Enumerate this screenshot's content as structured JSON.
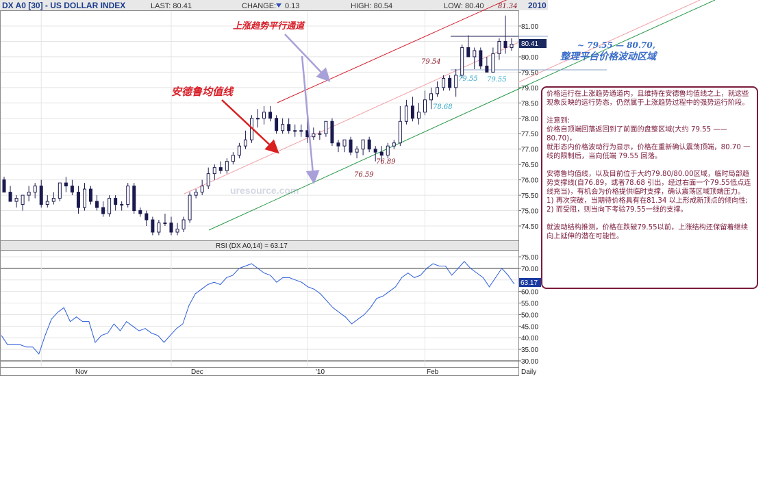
{
  "header": {
    "title": "DX A0 [30] - US DOLLAR INDEX",
    "last": "LAST: 80.41",
    "change_label": "CHANGE:",
    "change_value": "0.13",
    "high": "HIGH: 80.54",
    "low": "LOW: 80.40",
    "year": "2010"
  },
  "colors": {
    "candle_up": "#ffffff",
    "candle_down": "#1a1a50",
    "channel_upper": "#d42030",
    "channel_mid": "#f0a0a8",
    "support_line": "#2a9a4a",
    "rsi_line": "#2a5cd8",
    "arrow_red": "#d82020",
    "arrow_purple": "#a8a0d8",
    "note_border": "#7a1a3a"
  },
  "price_axis": {
    "ticks": [
      "81.00",
      "80.50",
      "80.00",
      "79.50",
      "79.00",
      "78.50",
      "78.00",
      "77.50",
      "77.00",
      "76.50",
      "76.00",
      "75.50",
      "75.00",
      "74.50"
    ],
    "last_price": "80.41"
  },
  "rsi_axis": {
    "label": "RSI (DX A0,14) = 63.17",
    "ticks": [
      "75.00",
      "70.00",
      "65.00",
      "60.00",
      "55.00",
      "50.00",
      "45.00",
      "40.00",
      "35.00",
      "30.00"
    ],
    "last_value": "63.17"
  },
  "x_axis": {
    "labels": [
      "Nov",
      "Dec",
      "'10",
      "Feb"
    ],
    "period": "Daily"
  },
  "watermark": "uresource.com",
  "annotations": {
    "channel": "上涨趋势平行通道",
    "ma": "安德鲁均值线",
    "range_text": "~ 79.55 — 80.70,",
    "range_label": "整理平台价格波动区域",
    "p8134": "81.34",
    "p7954": "79.54",
    "p7955a": "79.55",
    "p7955b": "79.55",
    "p7868": "78.68",
    "p7689": "76.89",
    "p7659": "76.59"
  },
  "note": {
    "p1": "价格运行在上涨趋势通道内，且维持在安德鲁均值线之上，就这些现象反映的运行势态，仍然属于上涨趋势过程中的强势运行阶段。",
    "p2a": "注意到:",
    "p2b": "价格自顶端回落返回到了前面的盘整区域(大约 79.55 —— 80.70)，",
    "p2c": "就形态内价格波动行为显示，价格在重新确认震荡顶端，80.70 一线的限制后，当向低端 79.55 回落。",
    "p3a": "安德鲁均值线，以及目前位于大约79.80/80.00区域，临时局部趋势支撑线(自76.89，或者78.68 引出，经过右面一个79.55低点连线充当)，有机会为价格提供临时支撑，确认震荡区域顶端压力。",
    "p3b": "1) 再次突破，当期待价格具有在81.34 以上形成新顶点的倾向性;",
    "p3c": "2) 而受阻，则当向下考验79.55一线的支撑。",
    "p4": "就波动结构推测，价格在跌破79.55以前，上涨结构还保留着继续向上延伸的潜在可能性。"
  },
  "chart_data": [
    {
      "type": "candlestick",
      "title": "DX A0 [30] - US DOLLAR INDEX",
      "ylim": [
        74.2,
        81.35
      ],
      "x": [
        "Oct-23",
        "Oct-26",
        "Oct-27",
        "Oct-28",
        "Oct-29",
        "Oct-30",
        "Nov-02",
        "Nov-03",
        "Nov-04",
        "Nov-05",
        "Nov-06",
        "Nov-09",
        "Nov-10",
        "Nov-11",
        "Nov-12",
        "Nov-13",
        "Nov-16",
        "Nov-17",
        "Nov-18",
        "Nov-19",
        "Nov-20",
        "Nov-23",
        "Nov-24",
        "Nov-25",
        "Nov-26",
        "Nov-27",
        "Nov-30",
        "Dec-01",
        "Dec-02",
        "Dec-03",
        "Dec-04",
        "Dec-07",
        "Dec-08",
        "Dec-09",
        "Dec-10",
        "Dec-11",
        "Dec-14",
        "Dec-15",
        "Dec-16",
        "Dec-17",
        "Dec-18",
        "Dec-21",
        "Dec-22",
        "Dec-23",
        "Dec-24",
        "Dec-28",
        "Dec-29",
        "Dec-30",
        "Dec-31",
        "Jan-04",
        "Jan-05",
        "Jan-06",
        "Jan-07",
        "Jan-08",
        "Jan-11",
        "Jan-12",
        "Jan-13",
        "Jan-14",
        "Jan-15",
        "Jan-19",
        "Jan-20",
        "Jan-21",
        "Jan-22",
        "Jan-25",
        "Jan-26",
        "Jan-27",
        "Jan-28",
        "Jan-29",
        "Feb-01",
        "Feb-02",
        "Feb-03",
        "Feb-04",
        "Feb-05",
        "Feb-08",
        "Feb-09",
        "Feb-10",
        "Feb-11",
        "Feb-12",
        "Feb-16",
        "Feb-17",
        "Feb-18",
        "Feb-19",
        "Feb-22"
      ],
      "open": [
        76.0,
        75.6,
        75.3,
        75.2,
        75.5,
        75.6,
        75.8,
        75.2,
        75.3,
        75.4,
        75.9,
        75.8,
        75.6,
        75.1,
        75.7,
        75.3,
        75.1,
        74.9,
        75.4,
        75.2,
        75.2,
        75.8,
        75.0,
        74.9,
        74.7,
        74.3,
        74.6,
        74.6,
        74.3,
        74.4,
        74.7,
        75.5,
        75.6,
        75.8,
        76.2,
        76.4,
        76.3,
        76.6,
        76.8,
        77.1,
        77.3,
        78.0,
        78.0,
        78.2,
        78.0,
        77.6,
        77.8,
        77.6,
        77.6,
        77.6,
        77.4,
        77.5,
        77.5,
        77.9,
        77.2,
        77.1,
        77.3,
        76.9,
        77.0,
        77.3,
        77.0,
        76.9,
        76.8,
        77.1,
        77.2,
        77.9,
        78.4,
        78.0,
        78.2,
        78.6,
        78.8,
        79.0,
        79.3,
        79.0,
        79.4,
        80.3,
        80.0,
        80.2,
        79.7,
        79.5,
        80.1,
        80.5,
        80.3
      ],
      "high": [
        76.1,
        75.8,
        75.5,
        75.5,
        75.8,
        75.9,
        76.0,
        75.5,
        75.6,
        75.9,
        76.1,
        76.0,
        75.8,
        75.9,
        75.8,
        75.5,
        75.3,
        75.5,
        75.5,
        75.3,
        75.9,
        75.9,
        75.1,
        75.0,
        74.8,
        74.7,
        74.9,
        74.8,
        74.6,
        74.8,
        75.6,
        75.7,
        76.0,
        76.4,
        76.5,
        76.6,
        76.7,
        76.9,
        77.2,
        77.6,
        78.1,
        78.3,
        78.4,
        78.4,
        78.1,
        78.0,
        78.0,
        77.8,
        77.8,
        78.1,
        77.7,
        77.6,
        77.9,
        78.0,
        77.3,
        77.3,
        77.4,
        77.1,
        77.3,
        77.4,
        77.1,
        77.1,
        77.2,
        77.3,
        78.4,
        78.6,
        78.7,
        78.5,
        78.9,
        79.0,
        79.2,
        79.4,
        79.4,
        79.6,
        80.4,
        80.7,
        80.3,
        80.3,
        80.0,
        80.3,
        80.6,
        81.34,
        80.6
      ],
      "low": [
        75.8,
        75.3,
        75.1,
        75.0,
        75.3,
        75.4,
        75.1,
        75.1,
        75.2,
        75.3,
        75.6,
        75.5,
        74.9,
        75.0,
        75.2,
        75.0,
        74.8,
        74.8,
        75.0,
        75.0,
        75.1,
        74.9,
        74.8,
        74.5,
        74.2,
        74.2,
        74.5,
        74.2,
        74.2,
        74.3,
        74.6,
        75.4,
        75.5,
        75.7,
        76.0,
        76.2,
        76.2,
        76.5,
        76.7,
        77.0,
        77.2,
        77.7,
        77.8,
        77.9,
        77.5,
        77.5,
        77.5,
        77.4,
        77.4,
        77.2,
        77.3,
        77.3,
        77.4,
        77.1,
        76.9,
        76.9,
        76.8,
        76.7,
        76.8,
        76.9,
        76.6,
        76.6,
        76.7,
        77.0,
        77.1,
        77.8,
        77.9,
        77.8,
        78.1,
        78.3,
        78.7,
        78.9,
        78.9,
        78.7,
        79.3,
        80.0,
        79.6,
        79.6,
        79.55,
        79.5,
        79.9,
        80.1,
        80.2
      ],
      "close": [
        75.6,
        75.3,
        75.4,
        75.5,
        75.6,
        75.8,
        75.2,
        75.3,
        75.4,
        75.9,
        75.8,
        75.6,
        75.1,
        75.7,
        75.3,
        75.1,
        74.9,
        75.4,
        75.2,
        75.2,
        75.8,
        75.0,
        74.9,
        74.7,
        74.3,
        74.6,
        74.6,
        74.3,
        74.4,
        74.7,
        75.5,
        75.6,
        75.8,
        76.2,
        76.4,
        76.3,
        76.6,
        76.8,
        77.1,
        77.3,
        78.0,
        78.0,
        78.2,
        78.0,
        77.6,
        77.8,
        77.6,
        77.6,
        77.6,
        77.4,
        77.5,
        77.5,
        77.9,
        77.2,
        77.1,
        77.3,
        76.9,
        77.0,
        77.3,
        77.0,
        76.9,
        76.8,
        77.1,
        77.2,
        77.9,
        78.4,
        78.0,
        78.2,
        78.6,
        78.8,
        79.0,
        79.3,
        79.0,
        79.4,
        80.3,
        80.0,
        80.2,
        79.7,
        79.5,
        80.1,
        80.5,
        80.3,
        80.41
      ]
    },
    {
      "type": "line",
      "title": "RSI (DX A0,14) = 63.17",
      "ylim": [
        30,
        75
      ],
      "series": [
        {
          "values": [
            41,
            37,
            37,
            37,
            36,
            36,
            33,
            41,
            48,
            51,
            53,
            47,
            49,
            47,
            47,
            38,
            41,
            42,
            46,
            43,
            47,
            45,
            43,
            44,
            42,
            41,
            38,
            41,
            44,
            46,
            54,
            59,
            61,
            63,
            64,
            63,
            66,
            67,
            70,
            71,
            72,
            70,
            68,
            67,
            64,
            66,
            66,
            65,
            64,
            62,
            61,
            59,
            56,
            53,
            51,
            49,
            46,
            48,
            50,
            53,
            57,
            58,
            60,
            62,
            66,
            68,
            66,
            67,
            70,
            72,
            71,
            71,
            67,
            70,
            73,
            70,
            68,
            66,
            62,
            66,
            70,
            67,
            63.17
          ]
        }
      ]
    }
  ]
}
